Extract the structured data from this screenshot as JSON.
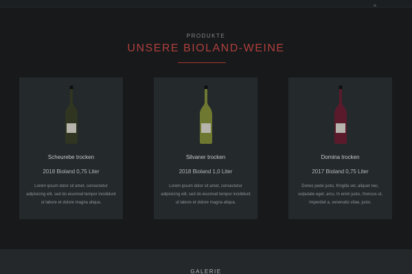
{
  "products": {
    "eyebrow": "PRODUKTE",
    "title": "UNSERE BIOLAND-WEINE",
    "accent_color": "#b0403c",
    "cards": [
      {
        "name": "Scheurebe trocken",
        "subtitle": "2018 Bioland 0,75 Liter",
        "description": "Lorem ipsum dolor sit amet, consectetur adipisicing elit, sed do eiusmod tempor incididunt ut labore et dolore magna aliqua.",
        "bottle_color": "#2f3520",
        "icon": "wine-bottle-icon"
      },
      {
        "name": "Silvaner trocken",
        "subtitle": "2018 Bioland 1,0 Liter",
        "description": "Lorem ipsum dolor sit amet, consectetur adipisicing elit, sed do eiusmod tempor incididunt ut labore et dolore magna aliqua.",
        "bottle_color": "#6f7830",
        "icon": "wine-bottle-icon"
      },
      {
        "name": "Domina trocken",
        "subtitle": "2017 Bioland 0,75 Liter",
        "description": "Donec pede justo, fringilla vel, aliquet nec, vulputate eget, arcu. In enim justo, rhoncus ut, imperdiet a, venenatis vitae, justo.",
        "bottle_color": "#5a1a2c",
        "icon": "wine-bottle-icon"
      }
    ]
  },
  "galerie": {
    "label": "GALERIE"
  }
}
